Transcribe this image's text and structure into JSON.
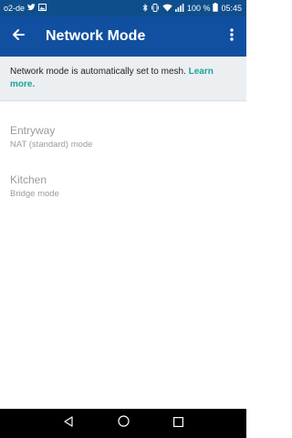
{
  "status_bar": {
    "carrier": "o2-de",
    "battery": "100 %",
    "time": "05:45",
    "icons": [
      "twitter-icon",
      "gallery-icon",
      "bluetooth-icon",
      "vibrate-icon",
      "wifi-icon",
      "signal-icon",
      "battery-icon"
    ]
  },
  "app_bar": {
    "title": "Network Mode",
    "back_icon": "arrow-left-icon",
    "menu_icon": "more-vertical-icon"
  },
  "banner": {
    "text": "Network mode is automatically set to mesh.",
    "link": "Learn more."
  },
  "nodes": [
    {
      "name": "Entryway",
      "mode": "NAT (standard) mode"
    },
    {
      "name": "Kitchen",
      "mode": "Bridge mode"
    }
  ],
  "nav_bar": {
    "icons": [
      "back-triangle-icon",
      "home-circle-icon",
      "recents-square-icon"
    ]
  },
  "colors": {
    "app_bar": "#1150a0",
    "status_bar": "#0f4e8c",
    "banner_bg": "#eceff2",
    "link": "#1aa59a",
    "muted_text": "#9b9b9b"
  }
}
